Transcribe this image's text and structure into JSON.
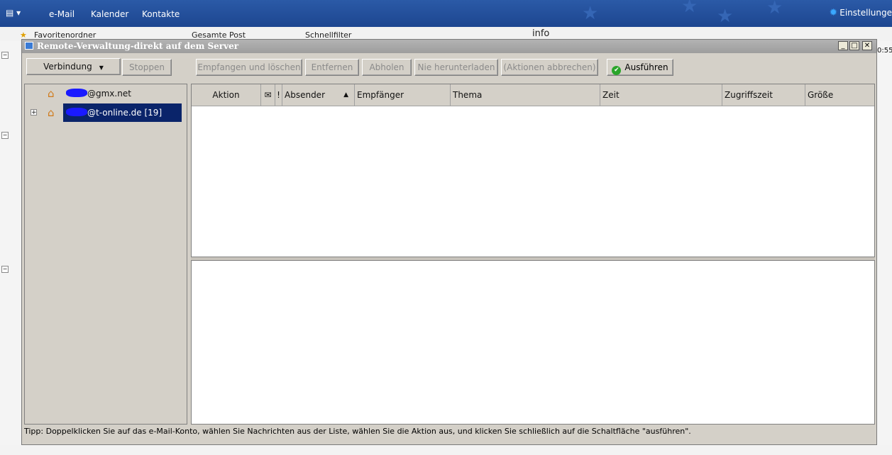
{
  "app": {
    "nav": [
      "e-Mail",
      "Kalender",
      "Kontakte"
    ],
    "settings_label": "Einstellunge",
    "bg_folder_label": "Favoritenordner",
    "bg_filter_label": "Gesamte Post",
    "bg_quickfilter_label": "Schnellfilter",
    "bg_info_label": "info",
    "bg_time": "0:55"
  },
  "dialog": {
    "title": "Remote-Verwaltung-direkt auf dem Server",
    "toolbar": {
      "connection": "Verbindung",
      "stop": "Stoppen",
      "receive_delete": "Empfangen und löschen",
      "remove": "Entfernen",
      "fetch": "Abholen",
      "never_download": "Nie herunterladen",
      "cancel_actions": "(Aktionen abbrechen)",
      "execute": "Ausführen"
    },
    "accounts": [
      {
        "label": "@gmx.net"
      },
      {
        "label": "@t-online.de [19]"
      }
    ],
    "columns": [
      "Aktion",
      "!",
      "Absender",
      "Empfänger",
      "Thema",
      "Zeit",
      "Zugriffszeit",
      "Größe"
    ],
    "tip": "Tipp: Doppelklicken Sie auf das e-Mail-Konto, wählen Sie Nachrichten aus der Liste, wählen Sie die Aktion aus, und klicken Sie schließlich auf die Schaltfläche \"ausführen\"."
  },
  "colors": {
    "topbar": "#1f4a93",
    "selection": "#0a246a",
    "dialog_bg": "#d4d0c8",
    "execute_icon": "#2aa52a"
  }
}
